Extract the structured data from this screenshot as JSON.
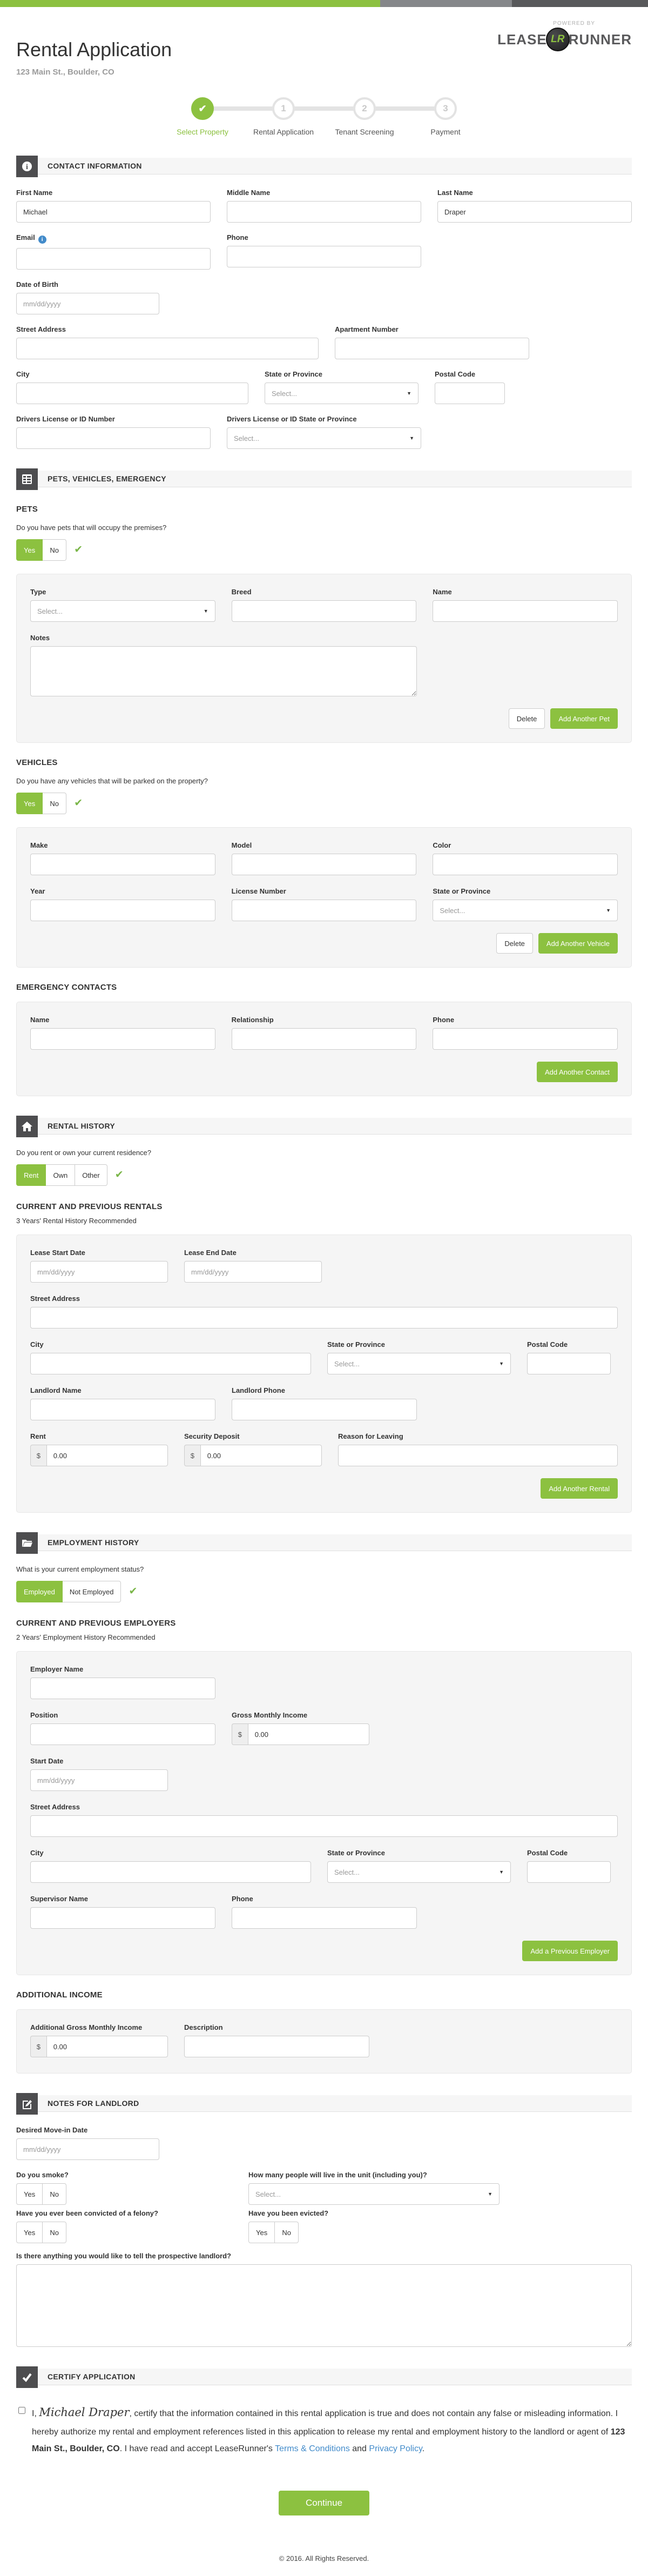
{
  "brand": {
    "powered_by": "POWERED BY",
    "word_left": "LEASE",
    "badge": "LR",
    "word_right": "RUNNER"
  },
  "header": {
    "title": "Rental Application",
    "subtitle": "123 Main St., Boulder, CO"
  },
  "stepper": {
    "steps": [
      {
        "label": "Select Property",
        "state": "done",
        "icon": "check"
      },
      {
        "label": "Rental Application",
        "number": "1"
      },
      {
        "label": "Tenant Screening",
        "number": "2"
      },
      {
        "label": "Payment",
        "number": "3"
      }
    ]
  },
  "contact": {
    "title": "CONTACT INFORMATION",
    "first_name": {
      "label": "First Name",
      "value": "Michael"
    },
    "middle_name": {
      "label": "Middle Name",
      "value": ""
    },
    "last_name": {
      "label": "Last Name",
      "value": "Draper"
    },
    "email": {
      "label": "Email",
      "value": ""
    },
    "phone": {
      "label": "Phone",
      "value": ""
    },
    "dob": {
      "label": "Date of Birth",
      "placeholder": "mm/dd/yyyy"
    },
    "street": {
      "label": "Street Address",
      "value": ""
    },
    "apt": {
      "label": "Apartment Number",
      "value": ""
    },
    "city": {
      "label": "City",
      "value": ""
    },
    "state": {
      "label": "State or Province",
      "placeholder": "Select..."
    },
    "postal": {
      "label": "Postal Code",
      "value": ""
    },
    "dl_number": {
      "label": "Drivers License or ID Number",
      "value": ""
    },
    "dl_state": {
      "label": "Drivers License or ID State or Province",
      "placeholder": "Select..."
    }
  },
  "pve": {
    "title": "PETS, VEHICLES, EMERGENCY",
    "pets": {
      "subhead": "PETS",
      "question": "Do you have pets that will occupy the premises?",
      "yes": "Yes",
      "no": "No",
      "selected": "Yes",
      "type": {
        "label": "Type",
        "placeholder": "Select..."
      },
      "breed": {
        "label": "Breed",
        "value": ""
      },
      "name": {
        "label": "Name",
        "value": ""
      },
      "notes": {
        "label": "Notes",
        "value": ""
      },
      "delete_label": "Delete",
      "add_label": "Add Another Pet"
    },
    "vehicles": {
      "subhead": "VEHICLES",
      "question": "Do you have any vehicles that will be parked on the property?",
      "yes": "Yes",
      "no": "No",
      "selected": "Yes",
      "make": {
        "label": "Make",
        "value": ""
      },
      "model": {
        "label": "Model",
        "value": ""
      },
      "color": {
        "label": "Color",
        "value": ""
      },
      "year": {
        "label": "Year",
        "value": ""
      },
      "license": {
        "label": "License Number",
        "value": ""
      },
      "state": {
        "label": "State or Province",
        "placeholder": "Select..."
      },
      "delete_label": "Delete",
      "add_label": "Add Another Vehicle"
    },
    "emergency": {
      "subhead": "EMERGENCY CONTACTS",
      "name": {
        "label": "Name",
        "value": ""
      },
      "relationship": {
        "label": "Relationship",
        "value": ""
      },
      "phone": {
        "label": "Phone",
        "value": ""
      },
      "add_label": "Add Another Contact"
    }
  },
  "rental": {
    "title": "RENTAL HISTORY",
    "question": "Do you rent or own your current residence?",
    "options": {
      "rent": "Rent",
      "own": "Own",
      "other": "Other",
      "selected": "Rent"
    },
    "subhead": "CURRENT AND PREVIOUS RENTALS",
    "note": "3 Years' Rental History Recommended",
    "lease_start": {
      "label": "Lease Start Date",
      "placeholder": "mm/dd/yyyy"
    },
    "lease_end": {
      "label": "Lease End Date",
      "placeholder": "mm/dd/yyyy"
    },
    "street": {
      "label": "Street Address",
      "value": ""
    },
    "city": {
      "label": "City",
      "value": ""
    },
    "state": {
      "label": "State or Province",
      "placeholder": "Select..."
    },
    "postal": {
      "label": "Postal Code",
      "value": ""
    },
    "landlord_name": {
      "label": "Landlord Name",
      "value": ""
    },
    "landlord_phone": {
      "label": "Landlord Phone",
      "value": ""
    },
    "rent": {
      "label": "Rent",
      "prefix": "$",
      "value": "0.00"
    },
    "deposit": {
      "label": "Security Deposit",
      "prefix": "$",
      "value": "0.00"
    },
    "reason": {
      "label": "Reason for Leaving",
      "value": ""
    },
    "add_label": "Add Another Rental"
  },
  "employment": {
    "title": "EMPLOYMENT HISTORY",
    "question": "What is your current employment status?",
    "options": {
      "employed": "Employed",
      "not_employed": "Not Employed",
      "selected": "Employed"
    },
    "subhead": "CURRENT AND PREVIOUS EMPLOYERS",
    "note": "2 Years' Employment History Recommended",
    "employer": {
      "label": "Employer Name",
      "value": ""
    },
    "position": {
      "label": "Position",
      "value": ""
    },
    "income": {
      "label": "Gross Monthly Income",
      "prefix": "$",
      "value": "0.00"
    },
    "start_date": {
      "label": "Start Date",
      "placeholder": "mm/dd/yyyy"
    },
    "street": {
      "label": "Street Address",
      "value": ""
    },
    "city": {
      "label": "City",
      "value": ""
    },
    "state": {
      "label": "State or Province",
      "placeholder": "Select..."
    },
    "postal": {
      "label": "Postal Code",
      "value": ""
    },
    "supervisor": {
      "label": "Supervisor Name",
      "value": ""
    },
    "phone": {
      "label": "Phone",
      "value": ""
    },
    "add_label": "Add a Previous Employer",
    "additional": {
      "subhead": "ADDITIONAL INCOME",
      "income": {
        "label": "Additional Gross Monthly Income",
        "prefix": "$",
        "value": "0.00"
      },
      "description": {
        "label": "Description",
        "value": ""
      }
    }
  },
  "notes": {
    "title": "NOTES FOR LANDLORD",
    "movein": {
      "label": "Desired Move-in Date",
      "placeholder": "mm/dd/yyyy"
    },
    "smoke": {
      "question": "Do you smoke?",
      "yes": "Yes",
      "no": "No"
    },
    "people": {
      "question": "How many people will live in the unit (including you)?",
      "placeholder": "Select..."
    },
    "felony": {
      "question": "Have you ever been convicted of a felony?",
      "yes": "Yes",
      "no": "No"
    },
    "evicted": {
      "question": "Have you been evicted?",
      "yes": "Yes",
      "no": "No"
    },
    "tell": {
      "question": "Is there anything you would like to tell the prospective landlord?",
      "value": ""
    }
  },
  "certify": {
    "title": "CERTIFY APPLICATION",
    "prefix": "I,",
    "signature": "Michael Draper",
    "body1": ", certify that the information contained in this rental application is true and does not contain any false or misleading information. I hereby authorize my rental and employment references listed in this application to release my rental and employment history to the landlord or agent of ",
    "address": "123 Main St., Boulder, CO",
    "body2": ". I have read and accept LeaseRunner's ",
    "terms_link": "Terms & Conditions",
    "and_text": " and ",
    "privacy_link": "Privacy Policy",
    "period": "."
  },
  "continue_label": "Continue",
  "footer": "© 2016. All Rights Reserved."
}
